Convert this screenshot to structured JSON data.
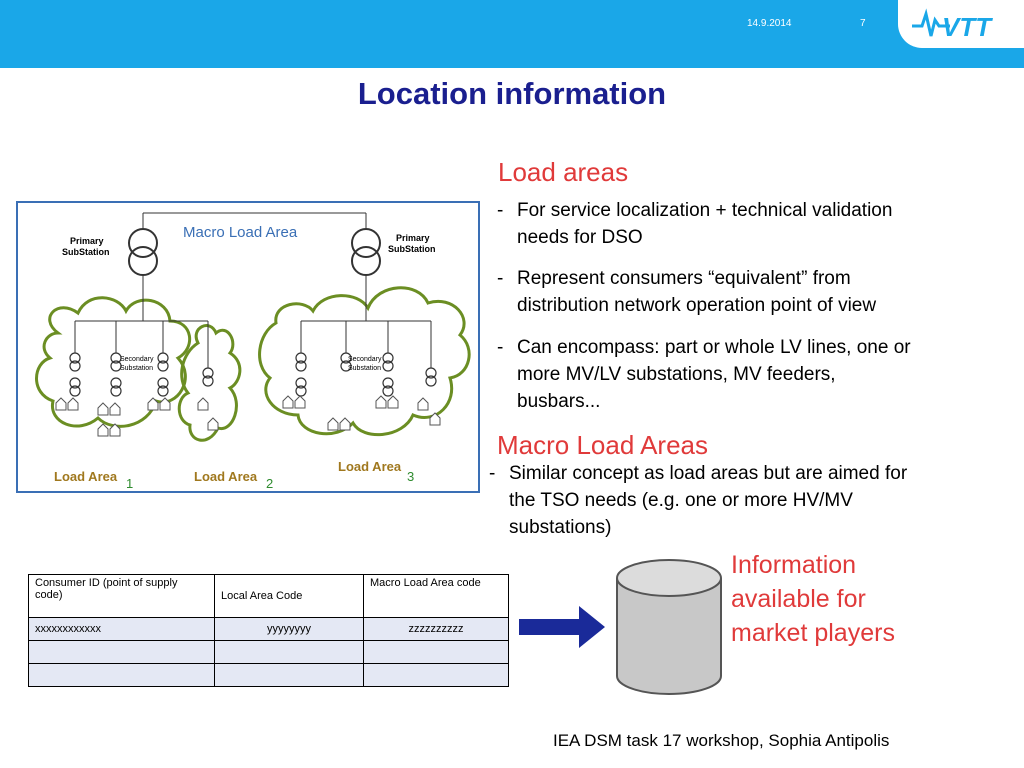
{
  "header": {
    "date": "14.9.2014",
    "page_number": "7",
    "logo_text": "VTT",
    "bar_color": "#1aa7e8"
  },
  "title": "Location information",
  "diagram": {
    "title": "Macro Load Area",
    "primary_substation_left": [
      "Primary",
      "SubStation"
    ],
    "primary_substation_right": [
      "Primary",
      "SubStation"
    ],
    "secondary_substation": [
      "Secondary",
      "Substation"
    ],
    "load_areas": [
      {
        "label": "Load Area",
        "subscript": "1"
      },
      {
        "label": "Load Area",
        "subscript": "2"
      },
      {
        "label": "Load Area",
        "subscript": "3"
      }
    ]
  },
  "load_areas": {
    "heading": "Load areas",
    "bullets": [
      {
        "dash": "-",
        "lines": [
          "For service localization + technical validation",
          "needs for DSO"
        ]
      },
      {
        "dash": "-",
        "lines": [
          "Represent consumers “equivalent” from",
          "distribution network operation point of view"
        ]
      },
      {
        "dash": "-",
        "lines": [
          "Can encompass: part or whole LV lines, one or",
          "more MV/LV substations, MV feeders,",
          "busbars..."
        ]
      }
    ]
  },
  "macro_load_areas": {
    "heading": "Macro Load Areas",
    "bullet": {
      "dash": "-",
      "lines": [
        "Similar concept as load areas but are aimed for",
        "the TSO needs (e.g. one or more HV/MV",
        "substations)"
      ]
    }
  },
  "table": {
    "headers": [
      "Consumer ID (point of supply code)",
      "Local Area Code",
      "Macro Load Area code"
    ],
    "rows": [
      [
        "xxxxxxxxxxxx",
        "yyyyyyyy",
        "zzzzzzzzzz"
      ],
      [
        "",
        "",
        ""
      ],
      [
        "",
        "",
        ""
      ]
    ]
  },
  "info": {
    "lines": [
      "Information",
      "available for",
      "market players"
    ]
  },
  "footer": "IEA DSM task 17 workshop, Sophia Antipolis",
  "colors": {
    "title": "#1a1f8f",
    "accent_red": "#e03a3a",
    "arrow": "#1a2a99",
    "cloud": "#6b8e23"
  }
}
